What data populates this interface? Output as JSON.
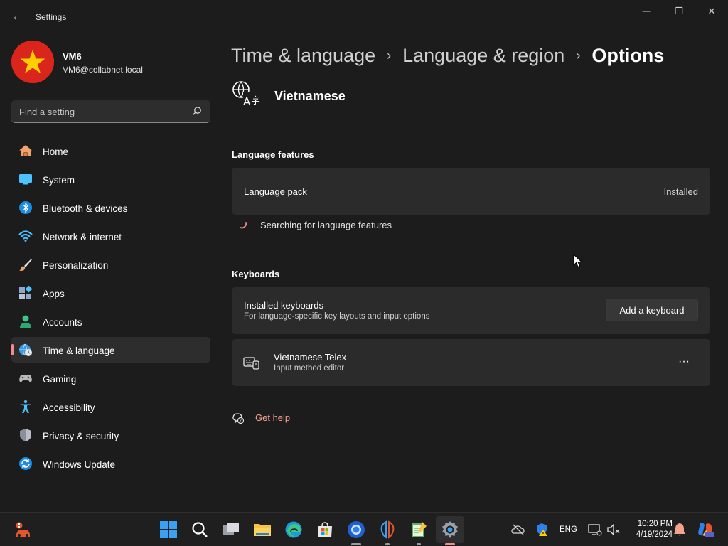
{
  "window": {
    "title": "Settings",
    "back_glyph": "←",
    "minimize_glyph": "—",
    "maximize_glyph": "❐",
    "close_glyph": "✕"
  },
  "profile": {
    "name": "VM6",
    "email": "VM6@collabnet.local",
    "avatar_icon": "vietnam-flag"
  },
  "search": {
    "placeholder": "Find a setting",
    "icon": "search-icon"
  },
  "sidebar": {
    "items": [
      {
        "label": "Home",
        "icon": "home-icon",
        "active": false
      },
      {
        "label": "System",
        "icon": "system-icon",
        "active": false
      },
      {
        "label": "Bluetooth & devices",
        "icon": "bluetooth-icon",
        "active": false
      },
      {
        "label": "Network & internet",
        "icon": "wifi-icon",
        "active": false
      },
      {
        "label": "Personalization",
        "icon": "brush-icon",
        "active": false
      },
      {
        "label": "Apps",
        "icon": "apps-icon",
        "active": false
      },
      {
        "label": "Accounts",
        "icon": "accounts-icon",
        "active": false
      },
      {
        "label": "Time & language",
        "icon": "globe-clock-icon",
        "active": true
      },
      {
        "label": "Gaming",
        "icon": "gamepad-icon",
        "active": false
      },
      {
        "label": "Accessibility",
        "icon": "accessibility-icon",
        "active": false
      },
      {
        "label": "Privacy & security",
        "icon": "shield-icon",
        "active": false
      },
      {
        "label": "Windows Update",
        "icon": "update-icon",
        "active": false
      }
    ]
  },
  "breadcrumb": {
    "items": [
      "Time & language",
      "Language & region",
      "Options"
    ],
    "separator": "›"
  },
  "language": {
    "name": "Vietnamese",
    "icon": "language-icon"
  },
  "language_features": {
    "title": "Language features",
    "language_pack_label": "Language pack",
    "language_pack_status": "Installed",
    "searching_text": "Searching for language features"
  },
  "keyboards": {
    "title": "Keyboards",
    "installed_label": "Installed keyboards",
    "installed_sub": "For language-specific key layouts and input options",
    "add_button": "Add a keyboard",
    "items": [
      {
        "name": "Vietnamese Telex",
        "type": "Input method editor",
        "more": "···"
      }
    ]
  },
  "help": {
    "label": "Get help"
  },
  "taskbar": {
    "apps": [
      "start-icon",
      "search-icon",
      "task-view-icon",
      "file-explorer-icon",
      "edge-icon",
      "store-icon",
      "chrome-icon",
      "app-icon",
      "notepad-icon",
      "settings-icon"
    ],
    "language": "ENG",
    "time": "10:20 PM",
    "date": "4/19/2024"
  },
  "colors": {
    "background": "#1c1c1c",
    "card": "#2b2b2b",
    "accent": "#f58a8a",
    "link": "#f4a38e"
  }
}
